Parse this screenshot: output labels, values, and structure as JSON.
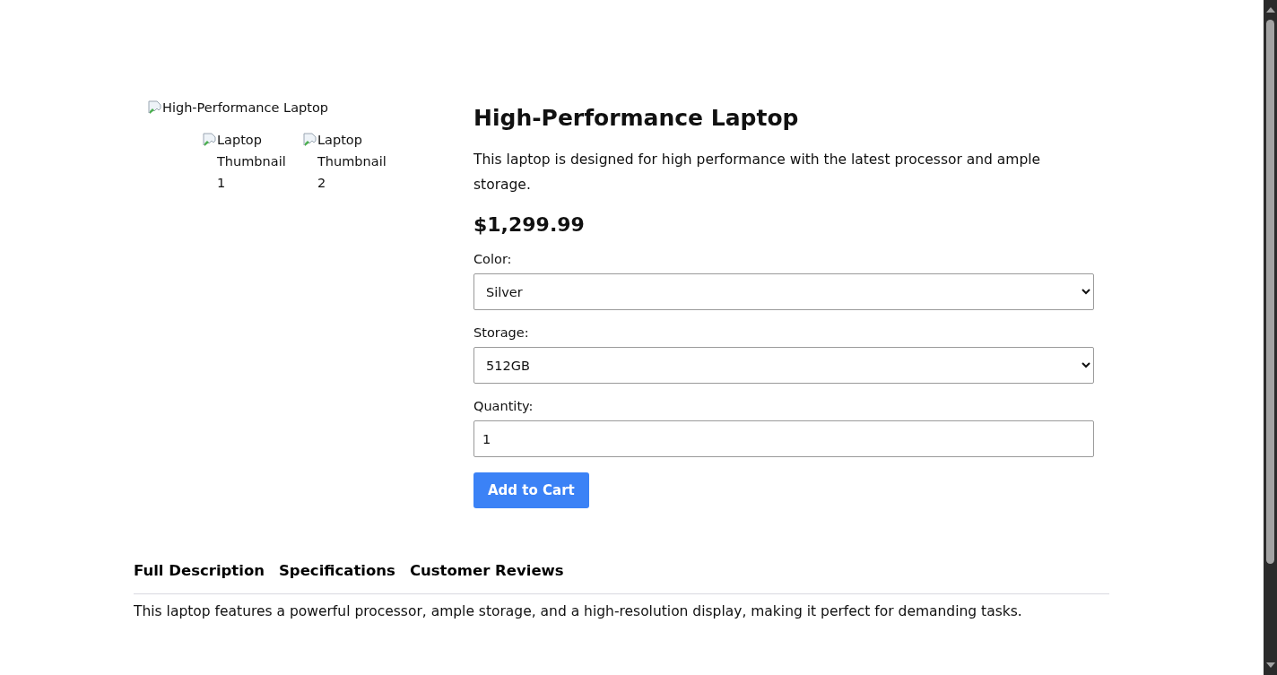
{
  "product": {
    "image_alt": "High-Performance Laptop",
    "thumbnails": [
      {
        "alt": "Laptop Thumbnail 1"
      },
      {
        "alt": "Laptop Thumbnail 2"
      }
    ],
    "title": "High-Performance Laptop",
    "description": "This laptop is designed for high performance with the latest processor and ample storage.",
    "price": "$1,299.99",
    "options": [
      {
        "kind": "select",
        "label": "Color:",
        "value": "Silver"
      },
      {
        "kind": "select",
        "label": "Storage:",
        "value": "512GB"
      },
      {
        "kind": "input",
        "label": "Quantity:",
        "value": "1"
      }
    ],
    "add_button": "Add to Cart"
  },
  "tabs": [
    {
      "label": "Full Description"
    },
    {
      "label": "Specifications"
    },
    {
      "label": "Customer Reviews"
    }
  ],
  "tab_content": "This laptop features a powerful processor, ample storage, and a high-resolution display, making it perfect for demanding tasks."
}
